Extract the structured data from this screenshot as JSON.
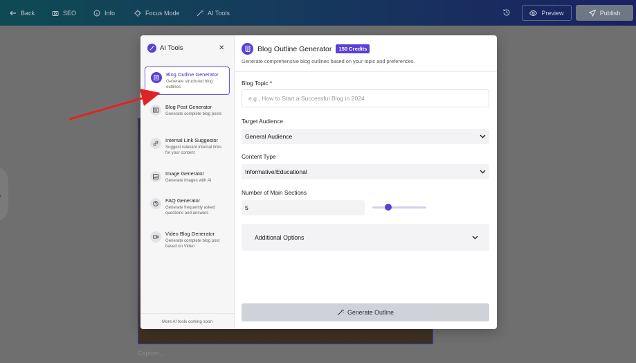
{
  "topbar": {
    "back": "Back",
    "seo": "SEO",
    "info": "Info",
    "focus_mode": "Focus Mode",
    "ai_tools": "AI Tools",
    "preview": "Preview",
    "publish": "Publish"
  },
  "background": {
    "caption": "Caption..."
  },
  "modal": {
    "sidebar": {
      "title": "AI Tools",
      "items": [
        {
          "title": "Blog Outline Generator",
          "desc": "Generate structured blog outlines",
          "icon": "document-icon",
          "active": true
        },
        {
          "title": "Blog Post Generator",
          "desc": "Generate complete blog posts",
          "icon": "article-icon"
        },
        {
          "title": "Internal Link Suggestor",
          "desc": "Suggest relevant internal links for your content",
          "icon": "link-icon"
        },
        {
          "title": "Image Generator",
          "desc": "Generate images with AI",
          "icon": "image-icon"
        },
        {
          "title": "FAQ Generator",
          "desc": "Generate frequently asked questions and answers",
          "icon": "question-icon"
        },
        {
          "title": "Video Blog Generator",
          "desc": "Generate complete blog post based on Video",
          "icon": "video-icon"
        }
      ],
      "footer": "More AI tools coming soon"
    },
    "main": {
      "title": "Blog Outline Generator",
      "credits": "150 Credits",
      "subtitle": "Generate comprehensive blog outlines based on your topic and preferences.",
      "topic_label": "Blog Topic *",
      "topic_placeholder": "e.g., How to Start a Successful Blog in 2024",
      "audience_label": "Target Audience",
      "audience_value": "General Audience",
      "content_type_label": "Content Type",
      "content_type_value": "Informative/Educational",
      "sections_label": "Number of Main Sections",
      "sections_value": "5",
      "sections_slider_fraction": 0.3,
      "additional_options": "Additional Options",
      "generate_button": "Generate Outline"
    }
  },
  "colors": {
    "accent": "#5b3fd6",
    "annotation_arrow": "#e02424"
  }
}
